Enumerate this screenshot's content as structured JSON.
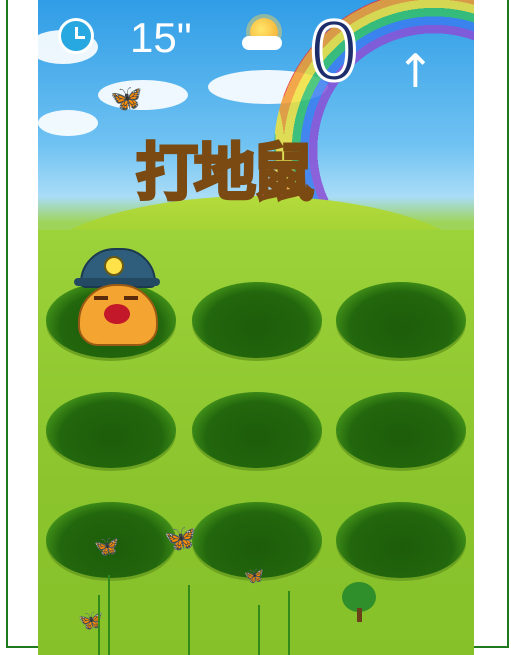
{
  "hud": {
    "timer_text": "15\"",
    "score": "0",
    "up_arrow": "↑"
  },
  "logo": {
    "text_part1": "打地",
    "text_part2": "鼠"
  },
  "holes": [
    {
      "row": 1,
      "col": 1,
      "has_mole": true
    },
    {
      "row": 1,
      "col": 2,
      "has_mole": false
    },
    {
      "row": 1,
      "col": 3,
      "has_mole": false
    },
    {
      "row": 2,
      "col": 1,
      "has_mole": false
    },
    {
      "row": 2,
      "col": 2,
      "has_mole": false
    },
    {
      "row": 2,
      "col": 3,
      "has_mole": false
    },
    {
      "row": 3,
      "col": 1,
      "has_mole": false
    },
    {
      "row": 3,
      "col": 2,
      "has_mole": false
    },
    {
      "row": 3,
      "col": 3,
      "has_mole": false
    }
  ],
  "colors": {
    "score": "#1d2d6b",
    "timer_icon": "#27a8e0",
    "frame_border": "#1f7a1f"
  },
  "icons": [
    "timer-icon",
    "sun-icon",
    "butterfly-icon",
    "mole-icon"
  ]
}
